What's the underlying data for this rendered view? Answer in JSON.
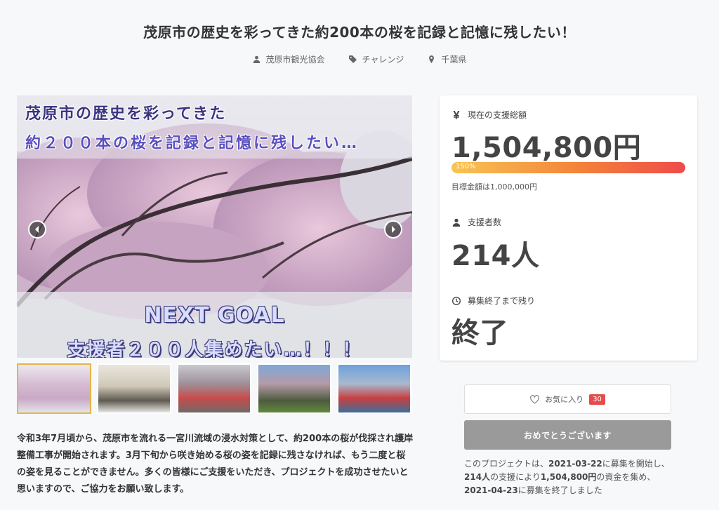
{
  "project": {
    "title": "茂原市の歴史を彩ってきた約200本の桜を記録と記憶に残したい！",
    "owner": "茂原市観光協会",
    "category": "チャレンジ",
    "location": "千葉県"
  },
  "hero": {
    "line1": "茂原市の歴史を彩ってきた",
    "line2": "約２００本の桜を記録と記憶に残したい…",
    "goal_line1": "NEXT GOAL",
    "goal_line2": "支援者２００人集めたい…！！！"
  },
  "description": "令和3年7月頃から、茂原市を流れる一宮川流域の浸水対策として、約200本の桜が伐採され護岸整備工事が開始されます。3月下旬から咲き始める桜の姿を記録に残さなければ、もう二度と桜の姿を見ることができません。多くの皆様にご支援をいただき、プロジェクトを成功させたいと思いますので、ご協力をお願い致します。",
  "stats": {
    "total_label": "現在の支援総額",
    "total_value": "1,504,800円",
    "progress_percent": 150,
    "progress_label": "150%",
    "goal_note": "目標金額は1,000,000円",
    "supporters_label": "支援者数",
    "supporters_value": "214人",
    "remaining_label": "募集終了まで残り",
    "remaining_value": "終了"
  },
  "actions": {
    "favorite_label": "お気に入り",
    "favorite_count": "30",
    "status_button": "おめでとうございます"
  },
  "summary": {
    "prefix": "このプロジェクトは、",
    "start_date": "2021-03-22",
    "mid1": "に募集を開始し、",
    "supporters": "214人",
    "mid2": "の支援により",
    "amount": "1,504,800円",
    "mid3": "の資金を集め、",
    "end_date": "2021-04-23",
    "suffix": "に募集を終了しました"
  },
  "colors": {
    "progress_start": "#f8c453",
    "progress_end": "#ee4b4b",
    "badge": "#e44c4c",
    "accent_border": "#e6b34a"
  }
}
